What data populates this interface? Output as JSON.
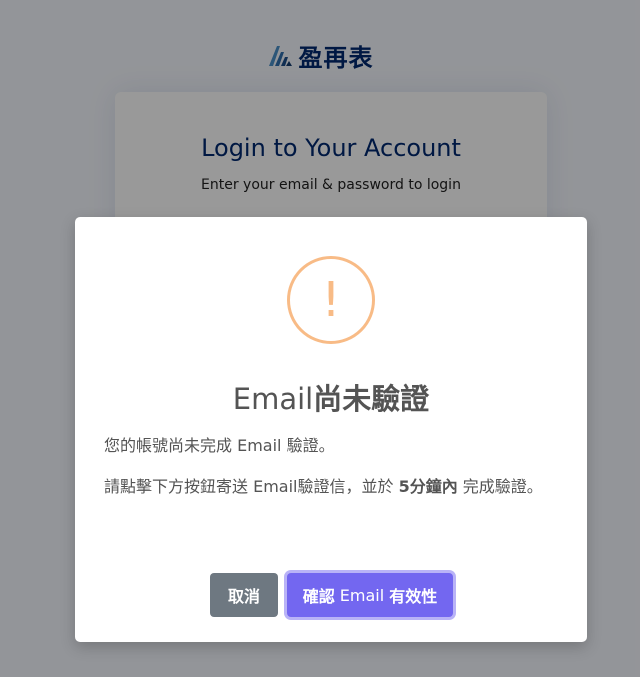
{
  "brand": {
    "name": "盈再表",
    "colors": {
      "logo_dark": "#012970",
      "logo_light": "#4154f1"
    }
  },
  "login": {
    "title": "Login to Your Account",
    "subtitle": "Enter your email & password to login"
  },
  "modal": {
    "icon": "warning-icon",
    "icon_glyph": "!",
    "icon_color": "#f8bb86",
    "title_prefix": "Email",
    "title_suffix": "尚未驗證",
    "line1": "您的帳號尚未完成 Email 驗證。",
    "line2_before": "請點擊下方按鈕寄送 Email驗證信，並於 ",
    "line2_bold": "5分鐘內",
    "line2_after": " 完成驗證。",
    "cancel_label": "取消",
    "confirm_bold1": "確認",
    "confirm_plain": " Email ",
    "confirm_bold2": "有效性",
    "colors": {
      "cancel": "#6e7881",
      "confirm": "#7367f0"
    }
  }
}
